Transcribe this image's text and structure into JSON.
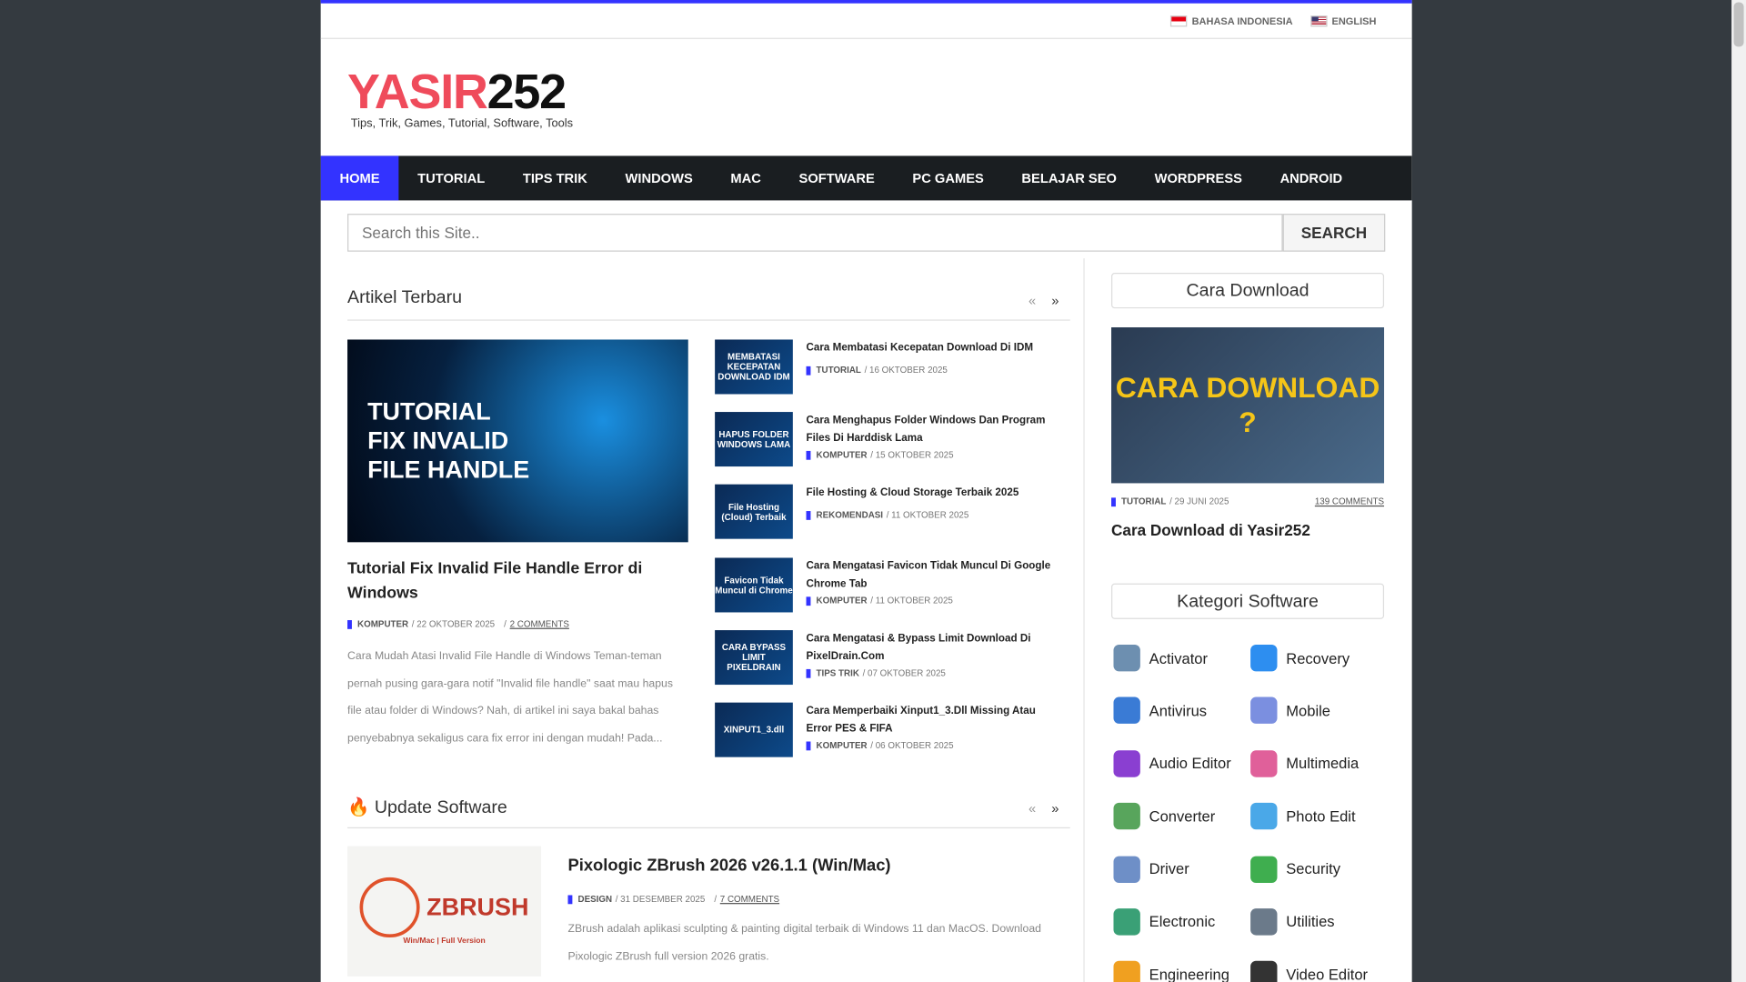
{
  "languages": [
    "BAHASA INDONESIA",
    "ENGLISH"
  ],
  "logo": {
    "name_red": "YASIR",
    "name_black": "252",
    "tagline": "Tips, Trik, Games, Tutorial,  Software, Tools"
  },
  "nav": [
    "HOME",
    "TUTORIAL",
    "TIPS TRIK",
    "WINDOWS",
    "MAC",
    "SOFTWARE",
    "PC GAMES",
    "BELAJAR SEO",
    "WORDPRESS",
    "ANDROID"
  ],
  "search": {
    "placeholder": "Search this Site..",
    "button": "SEARCH"
  },
  "latest": {
    "heading": "Artikel Terbaru",
    "featured": {
      "image_text": "TUTORIAL FIX INVALID FILE HANDLE",
      "title": "Tutorial Fix Invalid File Handle Error di Windows",
      "category": "KOMPUTER",
      "date": "/ 22 OKTOBER 2025",
      "comments": "2 COMMENTS",
      "excerpt": "Cara Mudah Atasi Invalid File Handle di Windows Teman-teman pernah pusing gara-gara notif \"Invalid file handle\" saat mau hapus file atau folder di Windows? Nah, di artikel ini saya bakal bahas penyebabnya sekaligus cara fix error ini dengan mudah! Pada..."
    },
    "items": [
      {
        "thumb": "MEMBATASI KECEPATAN DOWNLOAD IDM",
        "title": "Cara Membatasi Kecepatan Download Di IDM",
        "category": "TUTORIAL",
        "date": "/ 16 OKTOBER 2025"
      },
      {
        "thumb": "HAPUS FOLDER WINDOWS LAMA",
        "title": "Cara Menghapus Folder Windows Dan Program Files Di Harddisk Lama",
        "category": "KOMPUTER",
        "date": "/ 15 OKTOBER 2025"
      },
      {
        "thumb": "File Hosting (Cloud) Terbaik",
        "title": "File Hosting & Cloud Storage Terbaik 2025",
        "category": "REKOMENDASI",
        "date": "/ 11 OKTOBER 2025"
      },
      {
        "thumb": "Favicon Tidak Muncul di Chrome",
        "title": "Cara Mengatasi Favicon Tidak Muncul Di Google Chrome Tab",
        "category": "KOMPUTER",
        "date": "/ 11 OKTOBER 2025"
      },
      {
        "thumb": "CARA BYPASS LIMIT PIXELDRAIN",
        "title": "Cara Mengatasi & Bypass Limit Download Di PixelDrain.Com",
        "category": "TIPS TRIK",
        "date": "/ 07 OKTOBER 2025"
      },
      {
        "thumb": "XINPUT1_3.dll",
        "title": "Cara Memperbaiki Xinput1_3.Dll Missing Atau Error PES & FIFA",
        "category": "KOMPUTER",
        "date": "/ 06 OKTOBER 2025"
      }
    ]
  },
  "update": {
    "heading": "🔥 Update Software",
    "image_text": "ZBRUSH",
    "image_sub": "Win/Mac | Full Version",
    "title": "Pixologic ZBrush 2026 v26.1.1 (Win/Mac)",
    "category": "DESIGN",
    "date": "/ 31 DESEMBER 2025",
    "comments": "7 COMMENTS",
    "excerpt": "ZBrush adalah aplikasi sculpting & painting digital terbaik di Windows 11 dan MacOS. Download Pixologic ZBrush full version 2026 gratis."
  },
  "sidebar": {
    "download": {
      "heading": "Cara Download",
      "image_text": "CARA DOWNLOAD ?",
      "category": "TUTORIAL",
      "date": "/ 29 JUNI 2025",
      "comments": "139 COMMENTS",
      "title": "Cara Download di Yasir252"
    },
    "categories": {
      "heading": "Kategori Software",
      "items": [
        {
          "label": "Activator",
          "color": "#6d8fb0"
        },
        {
          "label": "Recovery",
          "color": "#2d8ef0"
        },
        {
          "label": "Antivirus",
          "color": "#3a7bd5"
        },
        {
          "label": "Mobile",
          "color": "#7b8fe0"
        },
        {
          "label": "Audio Editor",
          "color": "#8a3fd1"
        },
        {
          "label": "Multimedia",
          "color": "#e0609a"
        },
        {
          "label": "Converter",
          "color": "#58a55c"
        },
        {
          "label": "Photo Edit",
          "color": "#4aa8e8"
        },
        {
          "label": "Driver",
          "color": "#6e8fc7"
        },
        {
          "label": "Security",
          "color": "#3fae4f"
        },
        {
          "label": "Electronic",
          "color": "#3aa076"
        },
        {
          "label": "Utilities",
          "color": "#6b7a8a"
        },
        {
          "label": "Engineering",
          "color": "#f0a020"
        },
        {
          "label": "Video Editor",
          "color": "#333333"
        }
      ]
    }
  }
}
